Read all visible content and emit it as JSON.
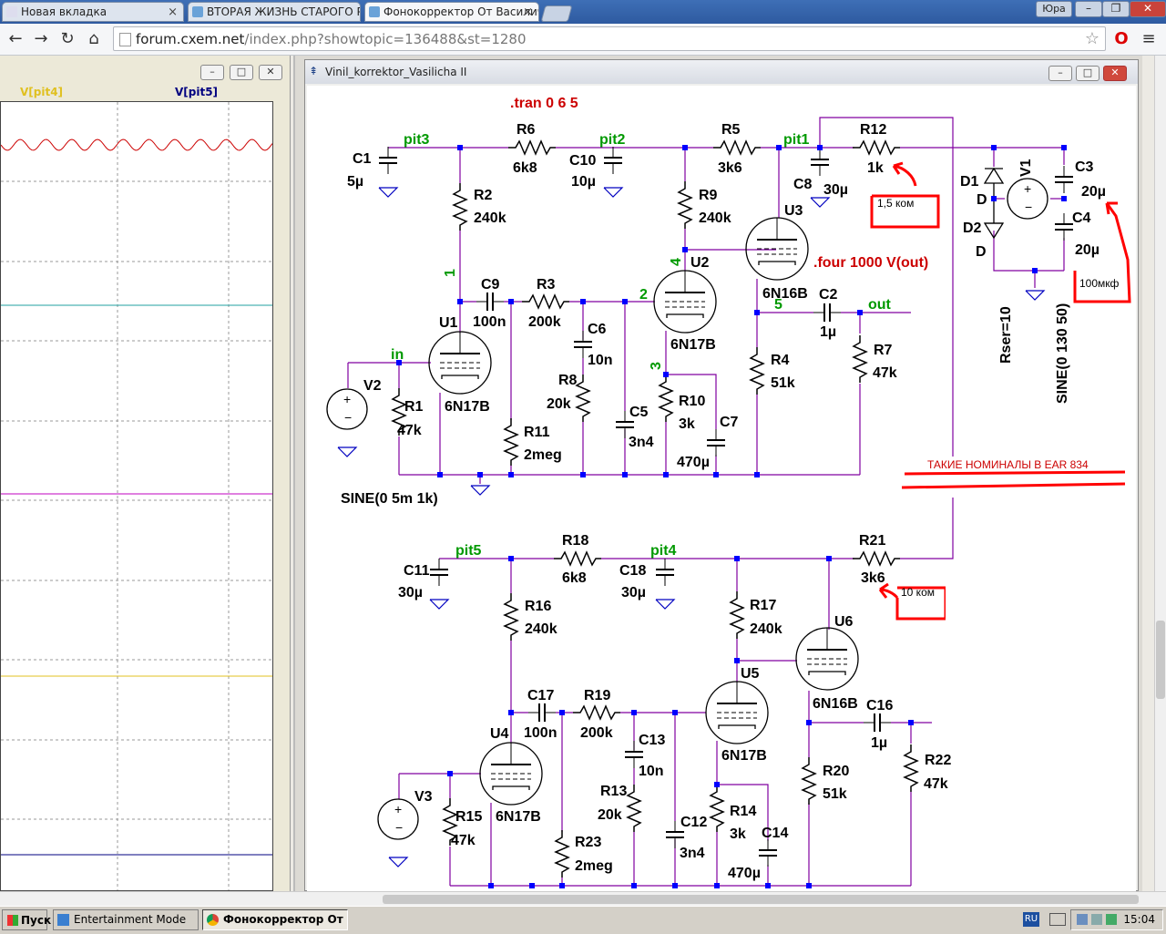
{
  "browser": {
    "tabs": [
      {
        "label": "Новая вкладка"
      },
      {
        "label": "ВТОРАЯ ЖИЗНЬ СТАРОГО Р"
      },
      {
        "label": "Фонокорректор От Василич"
      }
    ],
    "user_label": "Юра",
    "url_host": "forum.cxem.net",
    "url_path": "/index.php?showtopic=136488&st=1280"
  },
  "waveform": {
    "trace_labels": [
      "V[pit4]",
      "V[pit5]"
    ],
    "colors": {
      "pit4": "#e0c020",
      "pit5": "#000080",
      "signal": "#cc0000"
    }
  },
  "schematic": {
    "window_title": "Vinil_korrektor_Vasilicha II",
    "directives": {
      "tran": ".tran 0 6 5",
      "four": ".four 1000  V(out)"
    },
    "net_labels": [
      "pit3",
      "pit2",
      "pit1",
      "in",
      "out",
      "pit5",
      "pit4"
    ],
    "node_numbers": [
      "1",
      "2",
      "3",
      "4",
      "5"
    ],
    "components": {
      "C1": [
        "C1",
        "5µ"
      ],
      "R6": [
        "R6",
        "6k8"
      ],
      "C10": [
        "C10",
        "10µ"
      ],
      "R5": [
        "R5",
        "3k6"
      ],
      "C8": [
        "C8",
        "30µ"
      ],
      "R12": [
        "R12",
        "1k"
      ],
      "R2": [
        "R2",
        "240k"
      ],
      "R9": [
        "R9",
        "240k"
      ],
      "U3": [
        "U3",
        "6N16B"
      ],
      "C9": [
        "C9",
        "100n"
      ],
      "R3": [
        "R3",
        "200k"
      ],
      "U2": [
        "U2",
        "6N17B"
      ],
      "U1": [
        "U1",
        "6N17B"
      ],
      "C6": [
        "C6",
        "10n"
      ],
      "R8": [
        "R8",
        "20k"
      ],
      "C5": [
        "C5",
        "3n4"
      ],
      "R10": [
        "R10",
        "3k"
      ],
      "C7": [
        "C7",
        "470µ"
      ],
      "C2": [
        "C2",
        "1µ"
      ],
      "R4": [
        "R4",
        "51k"
      ],
      "R7": [
        "R7",
        "47k"
      ],
      "V2": [
        "V2",
        ""
      ],
      "R1": [
        "R1",
        "47k"
      ],
      "R11": [
        "R11",
        "2meg"
      ],
      "D1": [
        "D1",
        "D"
      ],
      "D2": [
        "D2",
        "D"
      ],
      "V1": [
        "V1",
        ""
      ],
      "C3": [
        "C3",
        "20µ"
      ],
      "C4": [
        "C4",
        "20µ"
      ],
      "C11": [
        "C11",
        "30µ"
      ],
      "R18": [
        "R18",
        "6k8"
      ],
      "C18": [
        "C18",
        "30µ"
      ],
      "R21": [
        "R21",
        "3k6"
      ],
      "R16": [
        "R16",
        "240k"
      ],
      "R17": [
        "R17",
        "240k"
      ],
      "U6": [
        "U6",
        "6N16B"
      ],
      "U5": [
        "U5",
        "6N17B"
      ],
      "C17": [
        "C17",
        "100n"
      ],
      "R19": [
        "R19",
        "200k"
      ],
      "C16": [
        "C16",
        "1µ"
      ],
      "U4": [
        "U4",
        "6N17B"
      ],
      "C13": [
        "C13",
        "10n"
      ],
      "R13": [
        "R13",
        "20k"
      ],
      "V3": [
        "V3",
        ""
      ],
      "R15": [
        "R15",
        "47k"
      ],
      "R23": [
        "R23",
        "2meg"
      ],
      "C12": [
        "C12",
        "3n4"
      ],
      "R14": [
        "R14",
        "3k"
      ],
      "C14": [
        "C14",
        "470µ"
      ],
      "R20": [
        "R20",
        "51k"
      ],
      "R22": [
        "R22",
        "47k"
      ]
    },
    "v2_source": "SINE(0 5m 1k)",
    "v1_rser": "Rser=10",
    "v1_source": "SINE(0 130 50)",
    "annotations": {
      "r12_note": "1,5 ком",
      "c4_note": "100мкф",
      "r21_note": "10 ком",
      "ear_note": "ТАКИЕ  НОМИНАЛЫ  В  EAR 834"
    },
    "colors": {
      "wire": "#8000a0",
      "node": "#0000ff",
      "label": "#000000",
      "net": "#009900",
      "directive": "#cc0000",
      "annotation": "#ff0000"
    }
  },
  "taskbar": {
    "start_label": "Пуск",
    "tasks": [
      "Entertainment Mode",
      "Фонокорректор От В..."
    ],
    "lang": "RU",
    "clock": "15:04"
  }
}
